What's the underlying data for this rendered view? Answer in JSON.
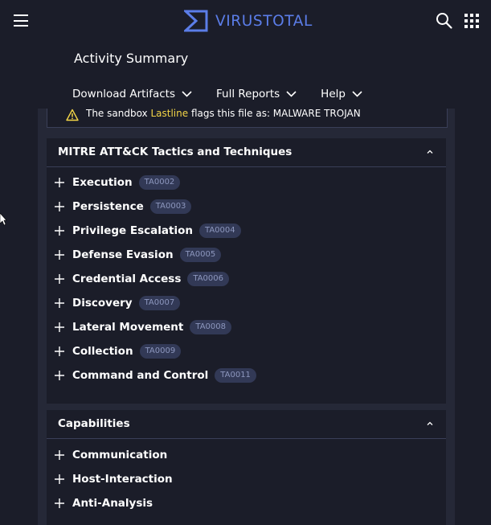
{
  "header": {
    "logo_text": "VIRUSTOTAL",
    "brand_color": "#5b7de8"
  },
  "activity": {
    "title": "Activity Summary",
    "menu": [
      {
        "label": "Download Artifacts"
      },
      {
        "label": "Full Reports"
      },
      {
        "label": "Help"
      }
    ]
  },
  "alert": {
    "prefix": "The sandbox ",
    "sandbox": "Lastline",
    "suffix": " flags this file as: MALWARE TROJAN",
    "highlight_color": "#f3d547"
  },
  "mitre": {
    "title": "MITRE ATT&CK Tactics and Techniques",
    "items": [
      {
        "label": "Execution",
        "tag": "TA0002"
      },
      {
        "label": "Persistence",
        "tag": "TA0003"
      },
      {
        "label": "Privilege Escalation",
        "tag": "TA0004"
      },
      {
        "label": "Defense Evasion",
        "tag": "TA0005"
      },
      {
        "label": "Credential Access",
        "tag": "TA0006"
      },
      {
        "label": "Discovery",
        "tag": "TA0007"
      },
      {
        "label": "Lateral Movement",
        "tag": "TA0008"
      },
      {
        "label": "Collection",
        "tag": "TA0009"
      },
      {
        "label": "Command and Control",
        "tag": "TA0011"
      }
    ]
  },
  "capabilities": {
    "title": "Capabilities",
    "items": [
      {
        "label": "Communication"
      },
      {
        "label": "Host-Interaction"
      },
      {
        "label": "Anti-Analysis"
      }
    ]
  },
  "icons": {
    "menu": "hamburger-menu-icon",
    "logo": "virustotal-logo-icon",
    "search": "search-icon",
    "apps": "apps-grid-icon",
    "warning": "warning-triangle-icon",
    "expand": "plus-icon",
    "collapse": "chevron-up-icon",
    "dropdown": "chevron-down-icon"
  }
}
